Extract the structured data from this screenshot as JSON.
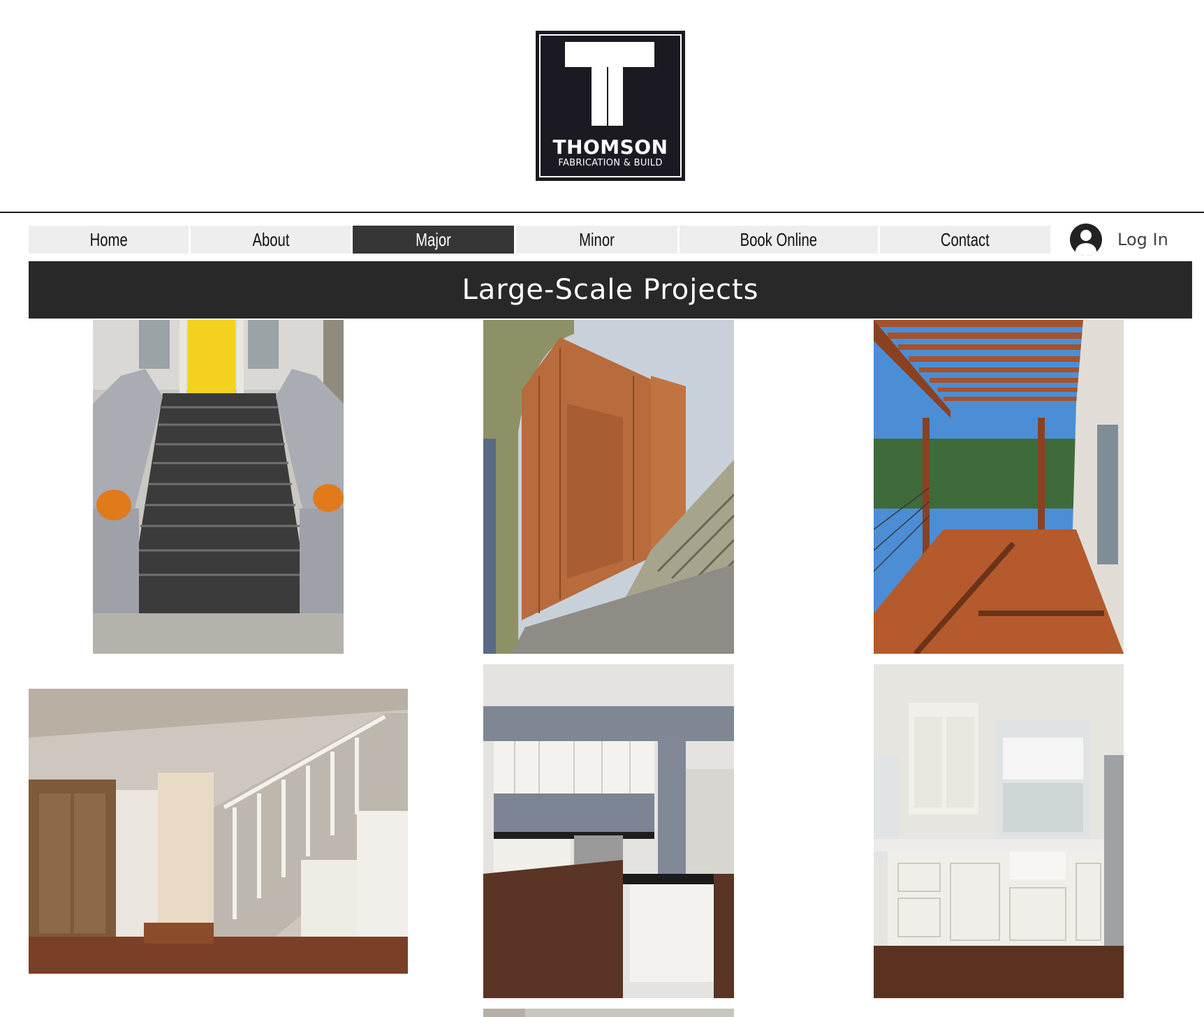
{
  "logo": {
    "word": "THOMSON",
    "sub": "FABRICATION & BUILD"
  },
  "nav": {
    "items": [
      {
        "label": "Home"
      },
      {
        "label": "About"
      },
      {
        "label": "Major",
        "active": true
      },
      {
        "label": "Minor"
      },
      {
        "label": "Book Online"
      },
      {
        "label": "Contact"
      }
    ],
    "login_label": "Log In"
  },
  "banner": {
    "title": "Large-Scale Projects"
  },
  "gallery": {
    "photos": [
      {
        "subject": "front-steps"
      },
      {
        "subject": "redwood-fence"
      },
      {
        "subject": "pergola-deck"
      },
      {
        "subject": "staircase-interior"
      },
      {
        "subject": "kitchen-island"
      },
      {
        "subject": "kitchen-sink"
      }
    ]
  },
  "colors": {
    "logo_bg": "#1b1a22",
    "nav_bg": "#eeeeee",
    "nav_active": "#363636",
    "banner_bg": "#282828"
  }
}
